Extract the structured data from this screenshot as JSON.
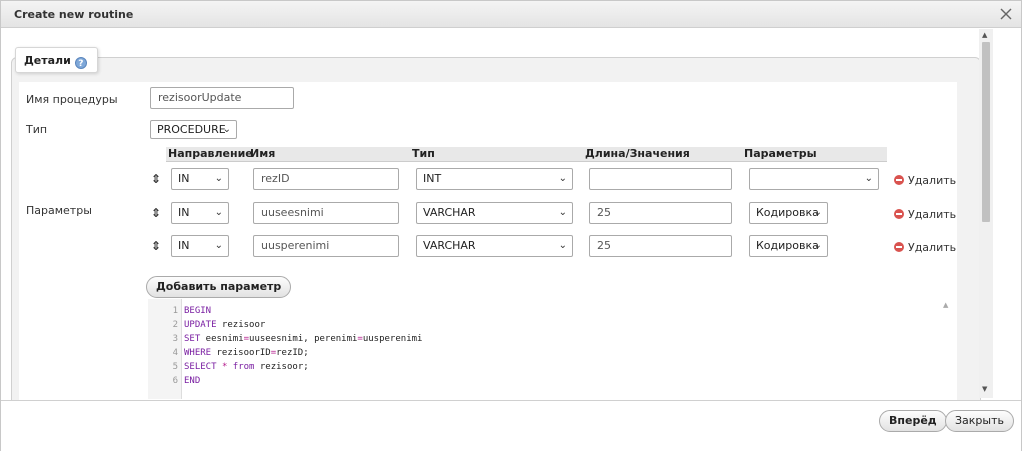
{
  "dialog": {
    "title": "Create new routine"
  },
  "tab": {
    "label": "Детали",
    "help_icon": "?"
  },
  "form": {
    "name_label": "Имя процедуры",
    "name_value": "rezisoorUpdate",
    "type_label": "Тип",
    "type_value": "PROCEDURE",
    "params_label": "Параметры"
  },
  "params_table": {
    "headers": [
      "Направление",
      "Имя",
      "Тип",
      "Длина/Значения",
      "Параметры"
    ],
    "rows": [
      {
        "direction": "IN",
        "name": "rezID",
        "type": "INT",
        "length": "",
        "options": "",
        "delete": "Удалить"
      },
      {
        "direction": "IN",
        "name": "uuseesnimi",
        "type": "VARCHAR",
        "length": "25",
        "options": "Кодировка",
        "delete": "Удалить"
      },
      {
        "direction": "IN",
        "name": "uusperenimi",
        "type": "VARCHAR",
        "length": "25",
        "options": "Кодировка",
        "delete": "Удалить"
      }
    ]
  },
  "add_param_button": "Добавить параметр",
  "code": {
    "line_numbers": [
      "1",
      "2",
      "3",
      "4",
      "5",
      "6"
    ],
    "lines": [
      [
        "BEGIN"
      ],
      [
        "UPDATE",
        " rezisoor"
      ],
      [
        "SET",
        " eesnimi",
        "=",
        "uuseesnimi, perenimi",
        "=",
        "uusperenimi"
      ],
      [
        "WHERE",
        " rezisoorID",
        "=",
        "rezID;"
      ],
      [
        "SELECT",
        " ",
        "*",
        " ",
        "from",
        " rezisoor;"
      ],
      [
        "END"
      ]
    ]
  },
  "footer": {
    "forward_button": "Вперёд",
    "close_button": "Закрыть"
  },
  "colors": {
    "keyword": "#7a1fa2",
    "operator": "#b31b8c",
    "delete_icon": "#d9534f"
  }
}
